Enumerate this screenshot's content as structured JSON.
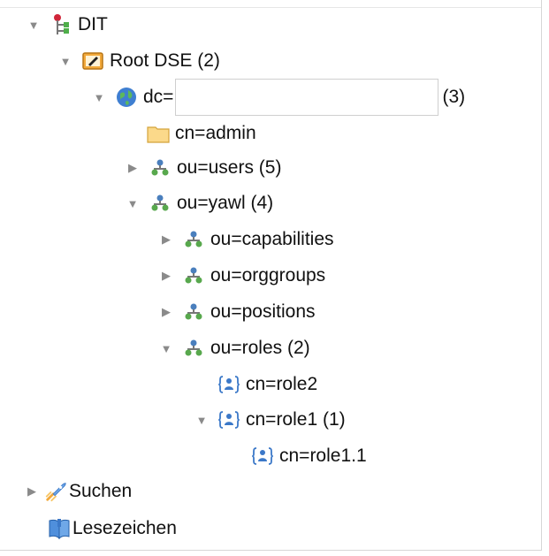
{
  "tree": {
    "dit": "DIT",
    "root_dse": "Root DSE (2)",
    "dc_prefix": "dc=",
    "dc_suffix": "(3)",
    "cn_admin": "cn=admin",
    "ou_users": "ou=users (5)",
    "ou_yawl": "ou=yawl (4)",
    "ou_capabilities": "ou=capabilities",
    "ou_orggroups": "ou=orggroups",
    "ou_positions": "ou=positions",
    "ou_roles": "ou=roles (2)",
    "cn_role2": "cn=role2",
    "cn_role1": "cn=role1 (1)",
    "cn_role1_1": "cn=role1.1",
    "suchen": "Suchen",
    "lesezeichen": "Lesezeichen"
  },
  "icons": {
    "expanded": "triangle-down",
    "collapsed": "triangle-right"
  }
}
